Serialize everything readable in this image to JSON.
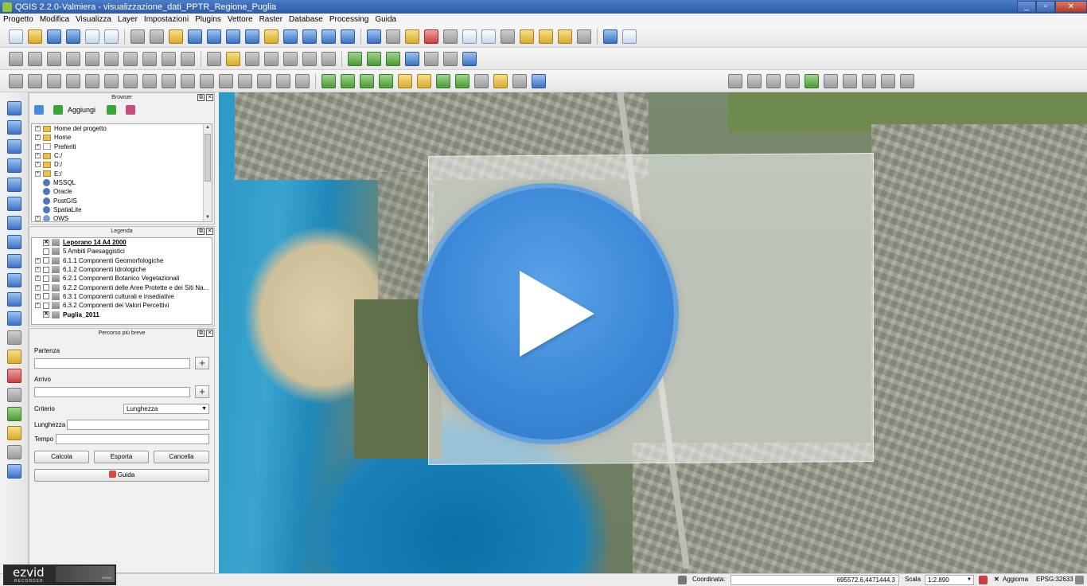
{
  "window": {
    "title": "QGIS 2.2.0-Valmiera - visualizzazione_dati_PPTR_Regione_Puglia"
  },
  "menu": [
    "Progetto",
    "Modifica",
    "Visualizza",
    "Layer",
    "Impostazioni",
    "Plugins",
    "Vettore",
    "Raster",
    "Database",
    "Processing",
    "Guida"
  ],
  "browser": {
    "title": "Browser",
    "add_label": "Aggiungi",
    "items": [
      "Home del progetto",
      "Home",
      "Preferiti",
      "C:/",
      "D:/",
      "E:/",
      "MSSQL",
      "Oracle",
      "PostGIS",
      "SpatiaLite",
      "OWS"
    ]
  },
  "legend": {
    "title": "Legenda",
    "items": [
      "Leporano 14 A4 2000",
      "5 Ambiti Paesaggistici",
      "6.1.1 Componenti Geomorfologiche",
      "6.1.2 Componenti Idrologiche",
      "6.2.1 Componenti Botanico Vegetazionali",
      "6.2.2 Componenti delle  Aree Protette e dei Siti Na...",
      "6.3.1 Componenti culturali e insediative",
      "6.3.2 Componenti dei Valori Percettivi",
      "Puglia_2011"
    ]
  },
  "route": {
    "title": "Percorso più breve",
    "start_label": "Partenza",
    "end_label": "Arrivo",
    "criterion_label": "Criterio",
    "criterion_value": "Lunghezza",
    "length_label": "Lunghezza",
    "time_label": "Tempo",
    "calc_label": "Calcola",
    "export_label": "Esporta",
    "cancel_label": "Cancella",
    "help_label": "Guida"
  },
  "status": {
    "coord_label": "Coordinata:",
    "coord_value": "695572.6,4471444.3",
    "scale_label": "Scala",
    "scale_value": "1:2.890",
    "refresh_label": "Aggiorna",
    "epsg": "EPSG:32633"
  },
  "watermark": {
    "brand": "ezvid",
    "sub": "RECORDER",
    "draw": "DRAW"
  },
  "colors": {
    "titlebar": "#2c5aa8",
    "play": "#3d88d8"
  }
}
